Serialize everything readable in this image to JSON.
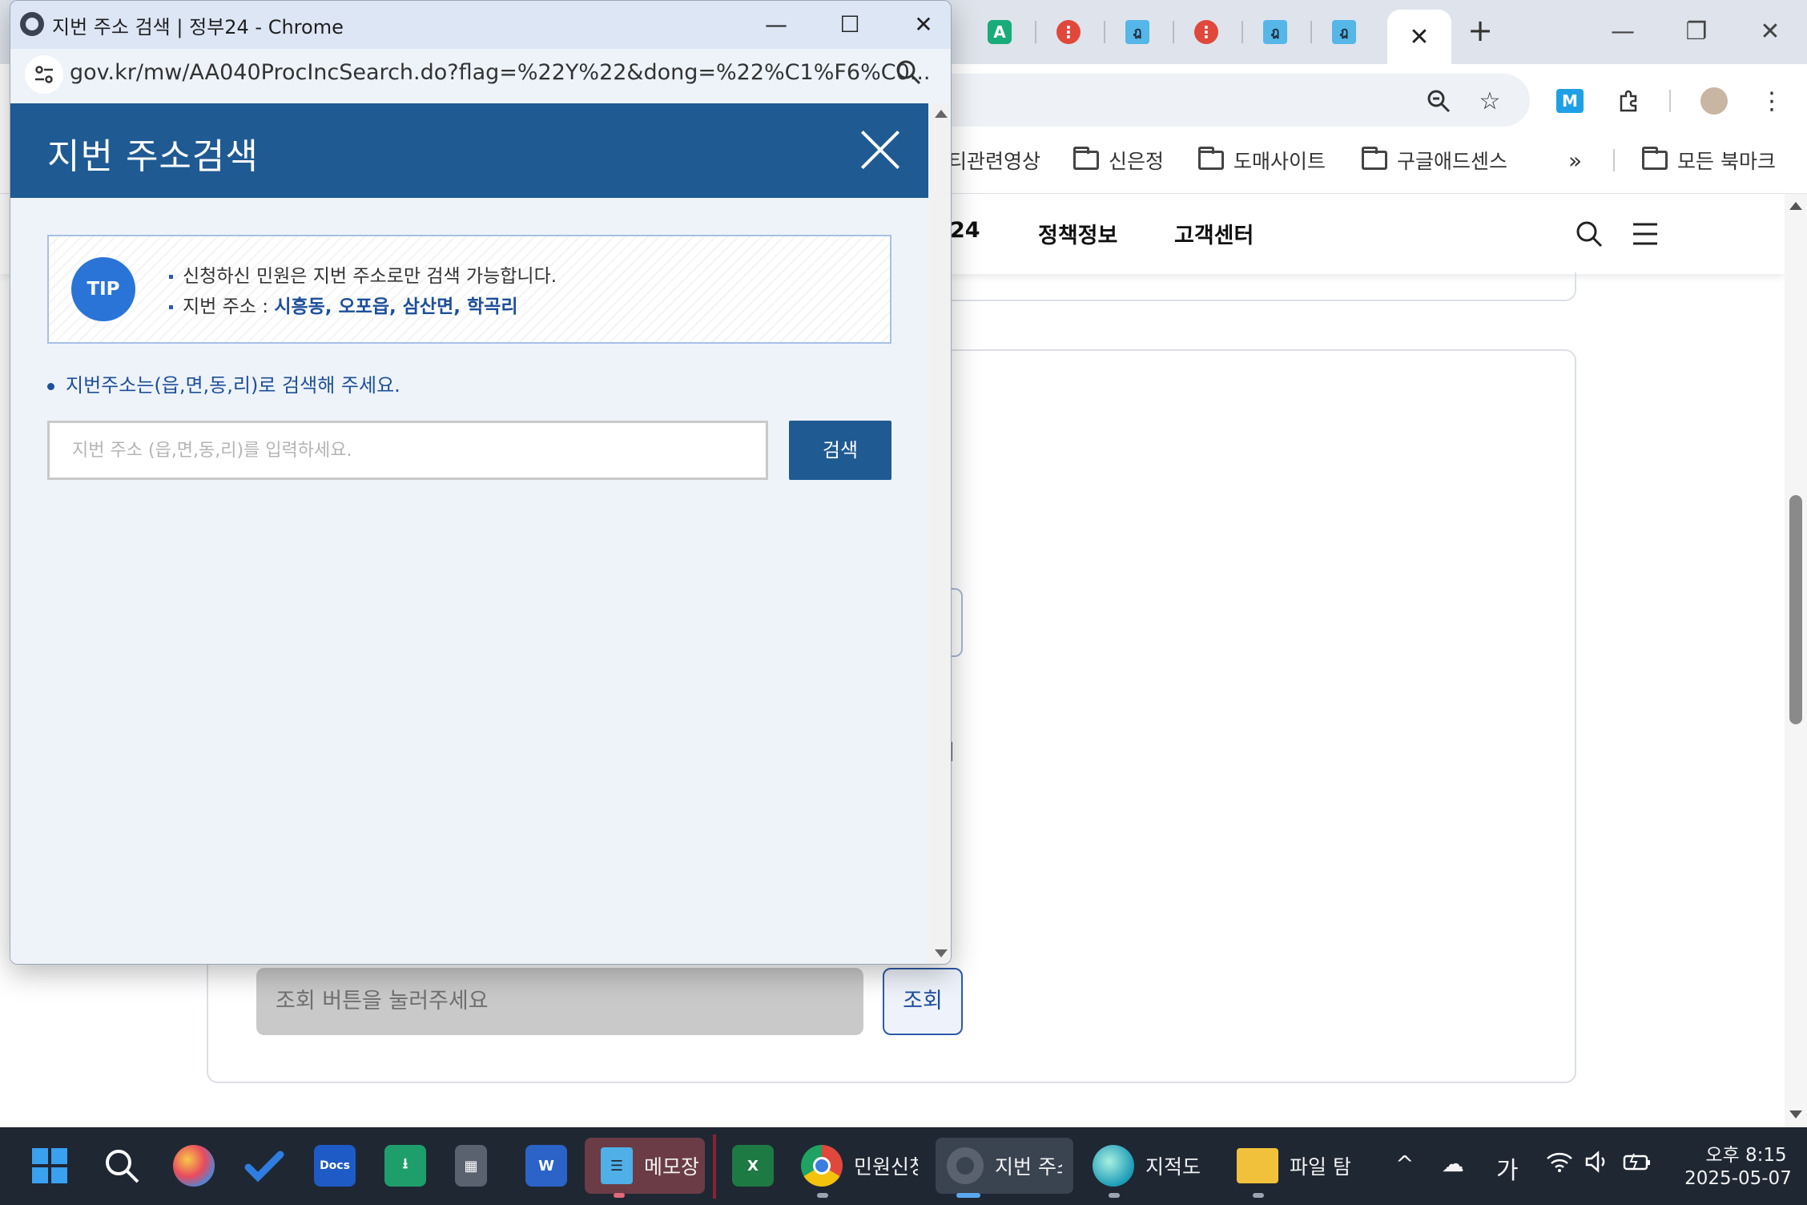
{
  "background_browser": {
    "bookmarks": [
      "티관련영상",
      "신은정",
      "도매사이트",
      "구글애드센스",
      "모든 북마크"
    ],
    "site_nav": [
      "24",
      "정책정보",
      "고객센터"
    ],
    "query_placeholder": "조회 버튼을 눌러주세요",
    "query_button": "조회",
    "active_tab_close": "✕",
    "new_tab": "+",
    "tab_favicons": [
      {
        "icon": "a-green-icon",
        "text": "A"
      },
      {
        "icon": "red-circle-icon",
        "text": "⋮"
      },
      {
        "icon": "blue-square-icon",
        "text": "ฎ"
      },
      {
        "icon": "red-circle-icon",
        "text": "⋮"
      },
      {
        "icon": "blue-square-icon",
        "text": "ฎ"
      },
      {
        "icon": "blue-square-icon",
        "text": "ฎ"
      }
    ]
  },
  "popup": {
    "window_title": "지번 주소 검색 | 정부24 - Chrome",
    "url": "gov.kr/mw/AA040ProcIncSearch.do?flag=%22Y%22&dong=%22%C1%F6%C0...",
    "dialog_title": "지번 주소검색",
    "tip_badge": "TIP",
    "tip_line1": "신청하신 민원은 지번 주소로만 검색 가능합니다.",
    "tip_line2_prefix": "지번 주소 : ",
    "tip_line2_examples": "시흥동, 오포읍, 삼산면, 학곡리",
    "guide_text": "지번주소는(읍,면,동,리)로 검색해 주세요.",
    "input_placeholder": "지번 주소 (읍,면,동,리)를 입력하세요.",
    "input_value": "",
    "search_button": "검색"
  },
  "taskbar": {
    "apps": [
      {
        "name": "start",
        "label": ""
      },
      {
        "name": "search",
        "label": ""
      },
      {
        "name": "paint",
        "label": ""
      },
      {
        "name": "todo",
        "label": ""
      },
      {
        "name": "docs",
        "label": "Docs"
      },
      {
        "name": "download",
        "label": ""
      },
      {
        "name": "calculator",
        "label": ""
      },
      {
        "name": "word",
        "label": "W"
      },
      {
        "name": "notepad",
        "label": "메모장"
      },
      {
        "name": "excel",
        "label": "X"
      },
      {
        "name": "chrome",
        "label": "민원신청"
      },
      {
        "name": "chrome-popup",
        "label": "지번 주소"
      },
      {
        "name": "map-app",
        "label": "지적도"
      },
      {
        "name": "file-explorer",
        "label": "파일 탐색기"
      }
    ],
    "ime": "가",
    "time": "오후 8:15",
    "date": "2025-05-07"
  },
  "colors": {
    "dialog_header": "#1f5a93",
    "tip_badge": "#2a74d8",
    "accent_text": "#1d4f9a"
  }
}
